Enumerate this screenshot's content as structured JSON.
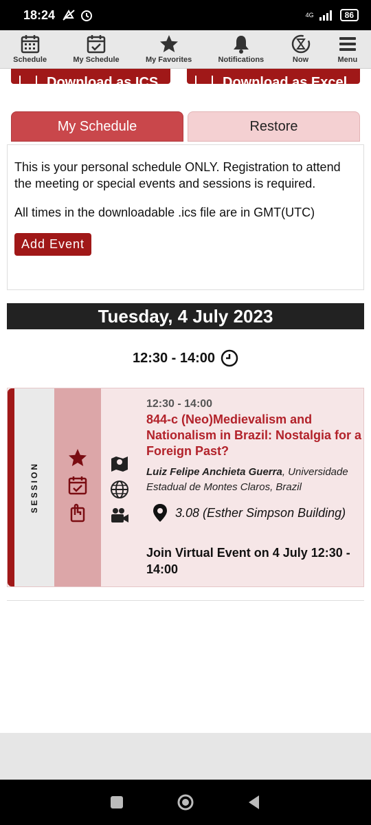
{
  "status_bar": {
    "time": "18:24",
    "network": "4G",
    "battery": "86"
  },
  "top_nav": {
    "items": [
      {
        "label": "Schedule",
        "icon": "calendar-grid-icon"
      },
      {
        "label": "My Schedule",
        "icon": "calendar-check-icon"
      },
      {
        "label": "My Favorites",
        "icon": "star-icon"
      },
      {
        "label": "Notifications",
        "icon": "bell-icon"
      },
      {
        "label": "Now",
        "icon": "hourglass-icon"
      },
      {
        "label": "Menu",
        "icon": "hamburger-icon"
      }
    ]
  },
  "download": {
    "ics_label": "Download as ICS",
    "excel_label": "Download as Excel"
  },
  "tabs": {
    "my_schedule": "My Schedule",
    "restore": "Restore"
  },
  "info": {
    "line1": "This is your personal schedule ONLY. Registration to attend the meeting or special events and sessions is required.",
    "line2": "All times in the downloadable .ics file are in GMT(UTC)",
    "add_event": "Add Event"
  },
  "day": {
    "header": "Tuesday, 4 July 2023",
    "slot_time": "12:30 - 14:00"
  },
  "session": {
    "type_label": "SESSION",
    "time": "12:30 - 14:00",
    "title": "844-c (Neo)Medievalism and Nationalism in Brazil: Nostalgia for a Foreign Past?",
    "author_name": "Luiz Felipe Anchieta Guerra",
    "author_affiliation": ", Universidade Estadual de Montes Claros, Brazil",
    "location": "3.08 (Esther Simpson Building)",
    "virtual": "Join Virtual Event on 4 July 12:30 - 14:00"
  },
  "colors": {
    "brand_red": "#a01818",
    "tab_active": "#c9474b",
    "tab_inactive": "#f4d0d2",
    "title_red": "#b2222a"
  }
}
